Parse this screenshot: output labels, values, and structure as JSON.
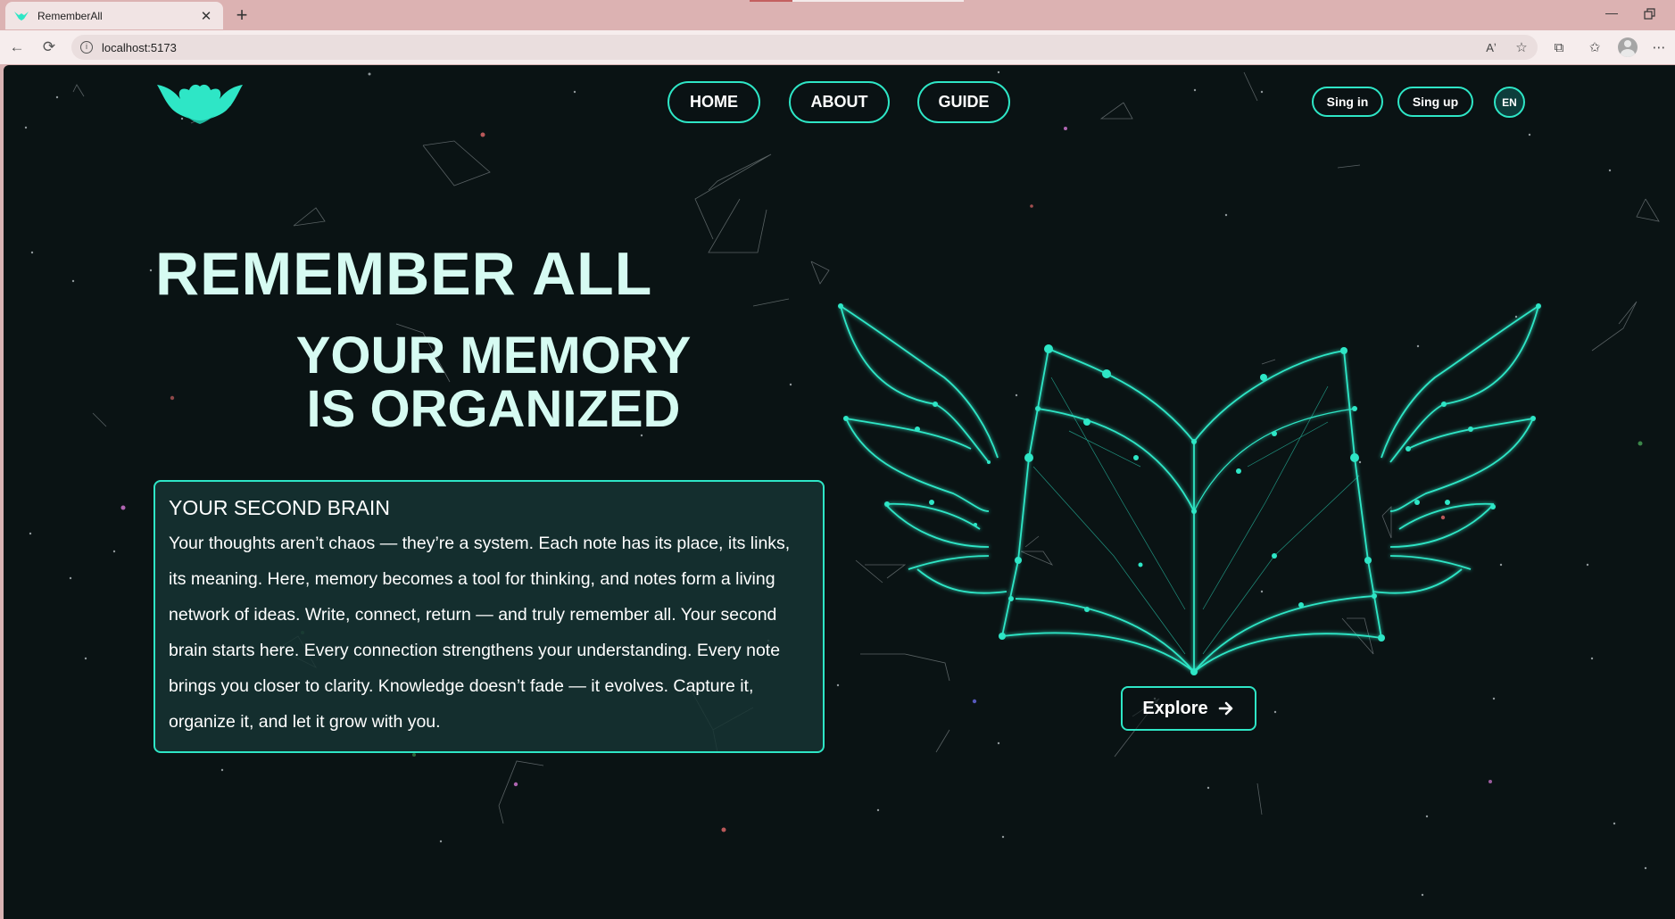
{
  "browser": {
    "tab_title": "RememberAll",
    "url": "localhost:5173"
  },
  "nav": {
    "links": [
      {
        "label": "HOME"
      },
      {
        "label": "ABOUT"
      },
      {
        "label": "GUIDE"
      }
    ],
    "sign_in": "Sing in",
    "sign_up": "Sing up",
    "language": "EN"
  },
  "hero": {
    "title": "REMEMBER ALL",
    "subtitle_line1": "YOUR MEMORY",
    "subtitle_line2": "IS ORGANIZED",
    "cta_label": "Explore"
  },
  "card": {
    "title": "YOUR SECOND BRAIN",
    "text": "Your thoughts aren’t chaos — they’re a system. Each note has its place, its links, its meaning. Here, memory becomes a tool for thinking, and notes form a living network of ideas. Write, connect, return — and truly remember all. Your second brain starts here. Every connection strengthens your understanding. Every note brings you closer to clarity. Knowledge doesn’t fade — it evolves. Capture it, organize it, and let it grow with you."
  },
  "colors": {
    "accent": "#2ee6c6",
    "background": "#0a1314",
    "heading": "#d6fbf2",
    "card_bg": "#163432"
  },
  "icons": {
    "logo": "winged-logo-icon",
    "explore": "arrow-right-icon"
  }
}
